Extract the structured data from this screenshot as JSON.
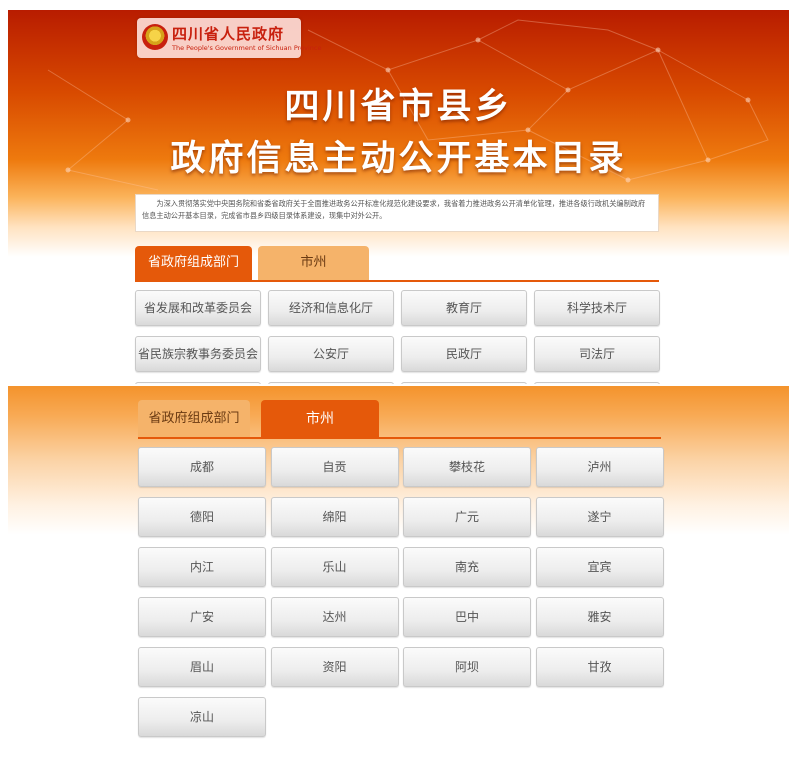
{
  "logo": {
    "name": "四川省人民政府",
    "english": "The People's Government of Sichuan Province"
  },
  "hero": {
    "line1": "四川省市县乡",
    "line2": "政府信息主动公开基本目录"
  },
  "intro_text": "为深入贯彻落实党中央国务院和省委省政府关于全面推进政务公开标准化规范化建设要求，我省着力推进政务公开清单化管理，推进各级行政机关编制政府信息主动公开基本目录，完成省市县乡四级目录体系建设，现集中对外公开。",
  "tabs": {
    "departments": "省政府组成部门",
    "cities": "市州"
  },
  "departments": [
    "省发展和改革委员会",
    "经济和信息化厅",
    "教育厅",
    "科学技术厅",
    "省民族宗教事务委员会",
    "公安厅",
    "民政厅",
    "司法厅"
  ],
  "cities": [
    "成都",
    "自贡",
    "攀枝花",
    "泸州",
    "德阳",
    "绵阳",
    "广元",
    "遂宁",
    "内江",
    "乐山",
    "南充",
    "宜宾",
    "广安",
    "达州",
    "巴中",
    "雅安",
    "眉山",
    "资阳",
    "阿坝",
    "甘孜",
    "凉山"
  ],
  "colors": {
    "accent": "#e5590a",
    "tab_inactive": "#f5b36a",
    "header_red": "#b81c00"
  }
}
